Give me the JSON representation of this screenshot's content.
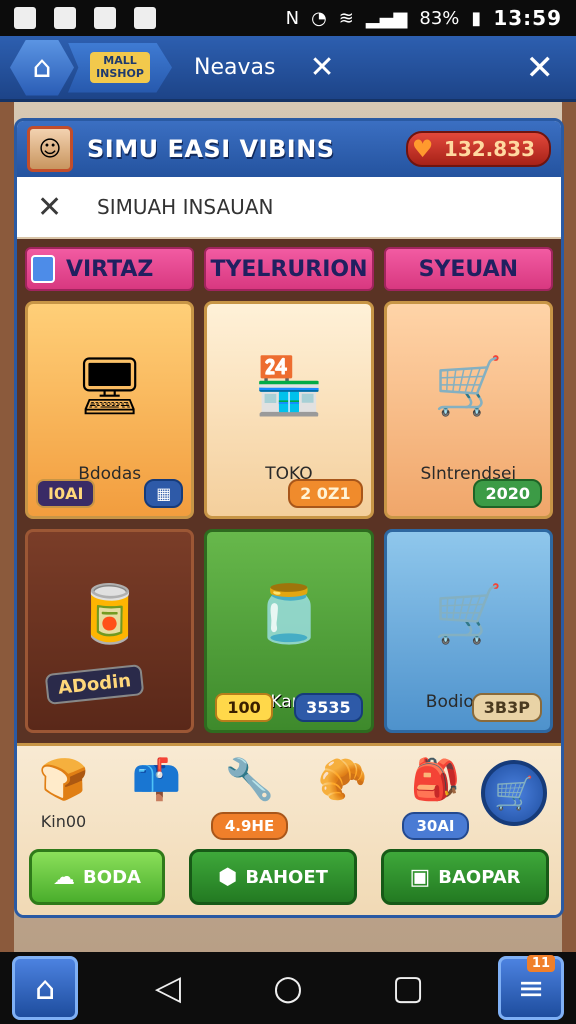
{
  "status_bar": {
    "battery": "83%",
    "time": "13:59"
  },
  "top_nav": {
    "logo_text": "MALL\nINSHOP",
    "title": "Neavas"
  },
  "panel": {
    "title": "SIMU EASI VIBINS",
    "coins": "132.833",
    "search_label": "SIMUAH INSAUAN"
  },
  "categories": [
    {
      "label": "VIRTAZ"
    },
    {
      "label": "TYELRURION"
    },
    {
      "label": "SYEUAN"
    }
  ],
  "cards": [
    {
      "name": "Bdodas",
      "left_tag": "I0AI",
      "icon": "electronics-icon"
    },
    {
      "name": "TOKO",
      "price": "2 0Z1",
      "icon": "shop-stall-icon"
    },
    {
      "name": "Slntrendsei",
      "price": "2020",
      "icon": "market-stall-icon"
    },
    {
      "name": "",
      "left_tag": "ADodin",
      "icon": "shelf-icon"
    },
    {
      "name": "Kars",
      "left_tag": "100",
      "price": "3535",
      "icon": "jars-icon"
    },
    {
      "name": "Bodiodors",
      "price": "3B3P",
      "icon": "cart-icon"
    }
  ],
  "tray": {
    "items": [
      {
        "label": "Kin00",
        "icon": "bread-icon"
      },
      {
        "label": "",
        "icon": "mailbox-icon"
      },
      {
        "chip": "4.9HE",
        "icon": "tools-icon"
      },
      {
        "label": "",
        "icon": "croissant-icon"
      },
      {
        "chip": "30AI",
        "icon": "bag-icon"
      }
    ],
    "actions": [
      {
        "label": "BODA"
      },
      {
        "label": "BAHOET"
      },
      {
        "label": "BAOPAR"
      }
    ]
  },
  "bottom_nav": {
    "menu_badge": "11"
  }
}
